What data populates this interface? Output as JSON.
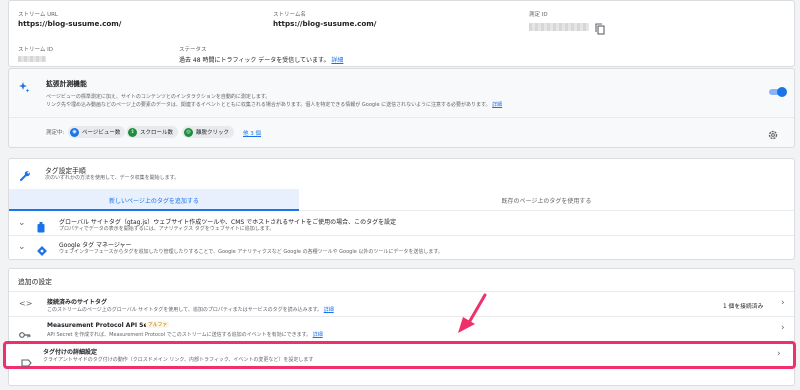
{
  "stream": {
    "url_label": "ストリーム URL",
    "url_value": "https://blog-susume.com/",
    "name_label": "ストリーム名",
    "name_value": "https://blog-susume.com/",
    "mid_label": "測定 ID",
    "id_label": "ストリーム ID",
    "status_label": "ステータス",
    "status_text": "過去 48 時間にトラフィック データを受信しています。",
    "status_link": "詳細"
  },
  "enhanced": {
    "title": "拡張計測機能",
    "desc1": "ページビューの標準測定に加え、サイトのコンテンツとのインタラクションを自動的に測定します。",
    "desc2": "リンク先や埋め込み動画などのページ上の要素のデータは、関連するイベントとともに収集される場合があります。個人を特定できる情報が Google に送信されないように注意する必要があります。",
    "desc_link": "詳細",
    "measuring_label": "測定中:",
    "chips": [
      "ページビュー数",
      "スクロール数",
      "離脱クリック"
    ],
    "more_link": "他 3 個",
    "toggle_on": true
  },
  "tag_setup": {
    "title": "タグ設定手順",
    "subtitle": "次のいずれかの方法を使用して、データ収集を開始します。",
    "tab_active": "新しいページ上のタグを追加する",
    "tab_inactive": "既存のページ上のタグを使用する",
    "options": [
      {
        "title": "グローバル サイトタグ（gtag.js）ウェブサイト作成ツールや、CMS でホストされるサイトをご使用の場合、このタグを設定",
        "desc": "プロパティでデータの表示を開始するには、アナリティクス タグをウェブサイトに追加します。"
      },
      {
        "title": "Google タグ マネージャー",
        "desc": "ウェブインターフェースからタグを追加したり管理したりすることで、Google アナリティクスなど Google の各種ツールや Google 以外のツールにデータを送信します。"
      }
    ]
  },
  "additional": {
    "heading": "追加の設定",
    "rows": [
      {
        "title": "接続済みのサイトタグ",
        "desc": "このストリームのページ上のグローバル サイトタグを使用して、追加のプロパティまたはサービスのタグを読み込みます。",
        "link": "詳細",
        "right": "1 個を接続済み"
      },
      {
        "title": "Measurement Protocol API Secret",
        "badge": "アルファ",
        "desc": "API Secret を作成すれば、Measurement Protocol でこのストリームに送信する追加のイベントを有効にできます。",
        "link": "詳細"
      },
      {
        "title": "タグ付けの詳細設定",
        "desc": "クライアントサイドのタグ付けの動作（クロスドメイン リンク、内部トラフィック、イベントの変更など）を設定します"
      }
    ]
  },
  "colors": {
    "accent": "#1a73e8",
    "highlight": "#f0306a"
  }
}
